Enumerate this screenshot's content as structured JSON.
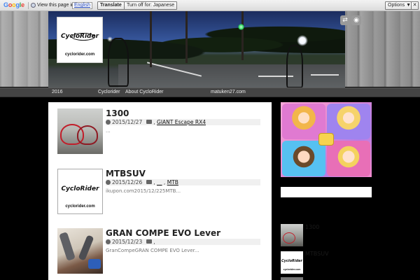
{
  "translate_bar": {
    "google_letters": [
      "G",
      "o",
      "o",
      "g",
      "l",
      "e"
    ],
    "google_colors": [
      "#4285f4",
      "#ea4335",
      "#fbbc05",
      "#4285f4",
      "#34a853",
      "#ea4335"
    ],
    "message": "View this page in:",
    "language": "English",
    "translate_label": "Translate",
    "turn_off_label": "Turn off for: Japanese",
    "options_label": "Options ▼",
    "close_label": "✕"
  },
  "header": {
    "logo_word": "CycloRider",
    "logo_url": "cyclorider.com",
    "share_icon": "share-icon",
    "rss_icon": "rss-icon"
  },
  "nav": {
    "items": [
      "2016",
      "Cyclorider",
      "About CycloRider",
      "matuken27.com"
    ]
  },
  "posts": [
    {
      "title": "1300",
      "date": "2015/12/27",
      "cat_prefix": ",",
      "category": "GIANT Escape RX4",
      "excerpt": "..."
    },
    {
      "title": "MTBSUV",
      "date": "2015/12/26",
      "cat_prefix": ",",
      "category": "__",
      "cat_sep": ",",
      "category2": "MTB",
      "excerpt": "ikupon.com2015/12/225MTB..."
    },
    {
      "title": "GRAN COMPE EVO Lever",
      "date": "2015/12/23",
      "cat_prefix": ",",
      "category": "",
      "excerpt": "GranCompeGRAN COMPE EVO Lever..."
    }
  ],
  "sidebar": {
    "recent": [
      {
        "label": "1300"
      },
      {
        "label": "MTBSUV"
      }
    ]
  },
  "colors": {
    "page_bg": "#000000",
    "nav_bg": "#444444",
    "content_bg": "#ffffff"
  }
}
